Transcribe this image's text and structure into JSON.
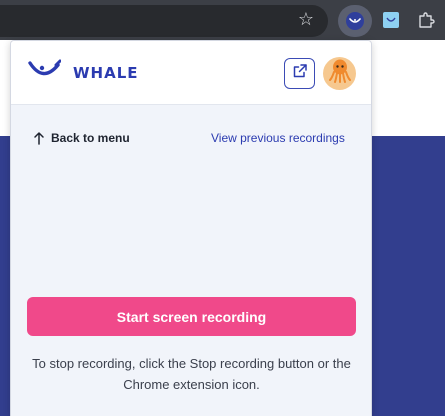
{
  "browser": {
    "star_glyph": "☆",
    "extensions": [
      "whale-icon",
      "extension-icon",
      "puzzle-icon"
    ]
  },
  "popup": {
    "brand": "WHALE",
    "brand_color": "#2b3bb0",
    "open_in_new_tab_icon": "external-link-icon",
    "avatar_icon": "octopus-icon"
  },
  "nav": {
    "back_label": "Back to menu",
    "previous_label": "View previous recordings"
  },
  "recording": {
    "start_label": "Start screen recording",
    "button_color": "#f0498a",
    "hint": "To stop recording, click the Stop recording button or the Chrome extension icon."
  },
  "page": {
    "background_color": "#323e8e"
  }
}
